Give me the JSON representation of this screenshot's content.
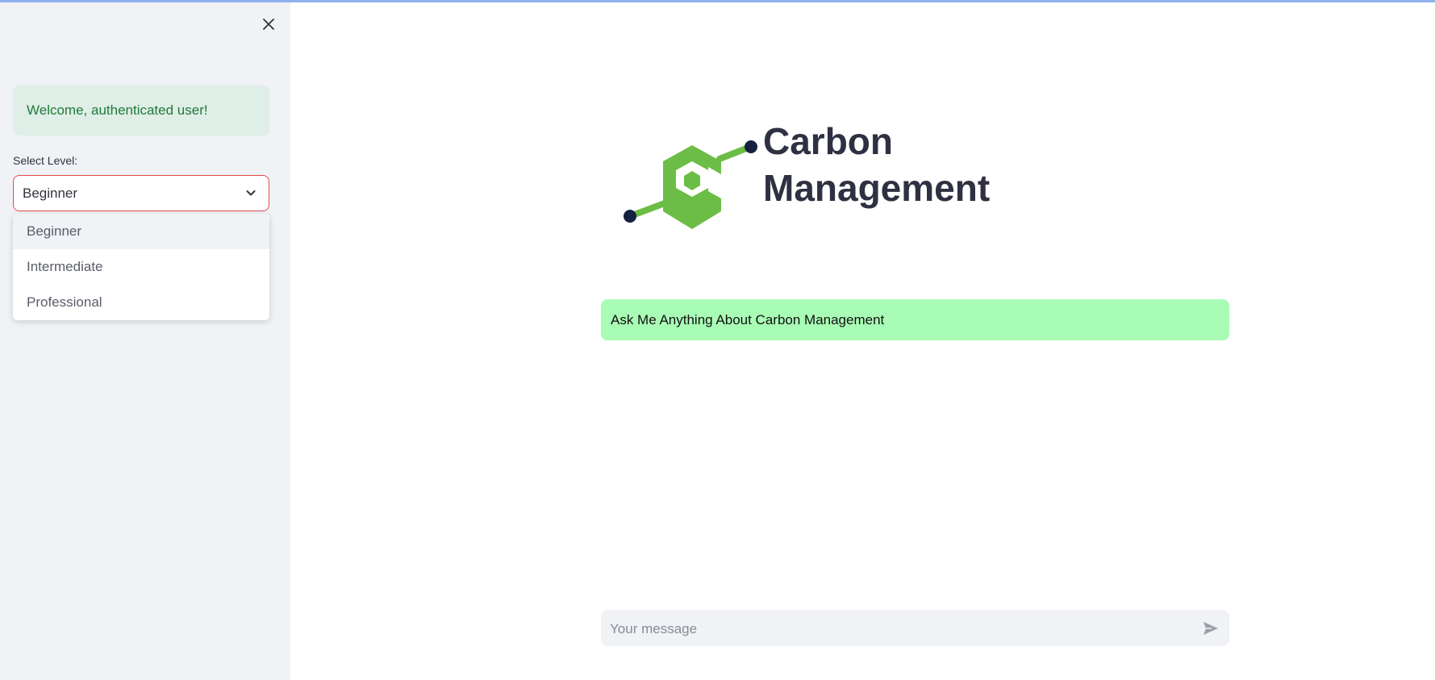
{
  "sidebar": {
    "welcome_text": "Welcome, authenticated user!",
    "select_label": "Select Level:",
    "selected_value": "Beginner",
    "options": [
      "Beginner",
      "Intermediate",
      "Professional"
    ]
  },
  "main": {
    "title_line1": "Carbon",
    "title_line2": "Management",
    "banner_text": "Ask Me Anything About Carbon Management",
    "chat_placeholder": "Your message"
  },
  "colors": {
    "accent_green": "#6cbd45",
    "banner_bg": "#a8fcb5",
    "error_border": "#e54a4a"
  },
  "icons": [
    "close-icon",
    "chevron-down-icon",
    "send-icon",
    "logo-icon"
  ]
}
